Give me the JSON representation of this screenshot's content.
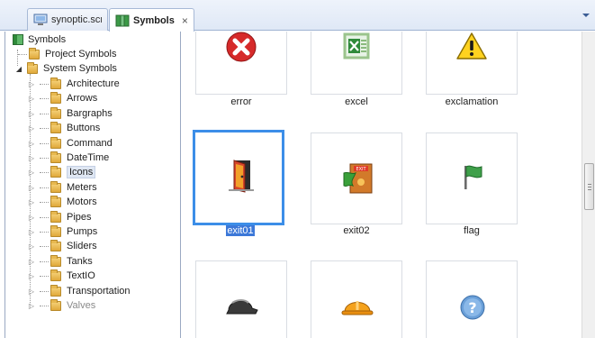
{
  "tabs": [
    {
      "label": "synoptic.scr",
      "icon": "screen-icon",
      "active": false
    },
    {
      "label": "Symbols",
      "icon": "symbols-icon",
      "active": true
    }
  ],
  "close_glyph": "×",
  "tree": {
    "root": "Symbols",
    "items": [
      {
        "label": "Project Symbols"
      },
      {
        "label": "System Symbols"
      },
      {
        "label": "Architecture"
      },
      {
        "label": "Arrows"
      },
      {
        "label": "Bargraphs"
      },
      {
        "label": "Buttons"
      },
      {
        "label": "Command"
      },
      {
        "label": "DateTime"
      },
      {
        "label": "Icons"
      },
      {
        "label": "Meters"
      },
      {
        "label": "Motors"
      },
      {
        "label": "Pipes"
      },
      {
        "label": "Pumps"
      },
      {
        "label": "Sliders"
      },
      {
        "label": "Tanks"
      },
      {
        "label": "TextIO"
      },
      {
        "label": "Transportation"
      },
      {
        "label": "Valves"
      }
    ]
  },
  "symbols": [
    {
      "name": "error",
      "icon": "error-icon"
    },
    {
      "name": "excel",
      "icon": "excel-icon"
    },
    {
      "name": "exclamation",
      "icon": "exclamation-icon"
    },
    {
      "name": "exit01",
      "icon": "exit-door-icon",
      "selected": true
    },
    {
      "name": "exit02",
      "icon": "exit-sign-icon"
    },
    {
      "name": "flag",
      "icon": "flag-icon"
    },
    {
      "name": "",
      "icon": "hardhat-dark-icon"
    },
    {
      "name": "",
      "icon": "hardhat-icon"
    },
    {
      "name": "",
      "icon": "help-icon"
    }
  ],
  "colors": {
    "selection": "#3c8ee8",
    "accent": "#3c78d8"
  }
}
